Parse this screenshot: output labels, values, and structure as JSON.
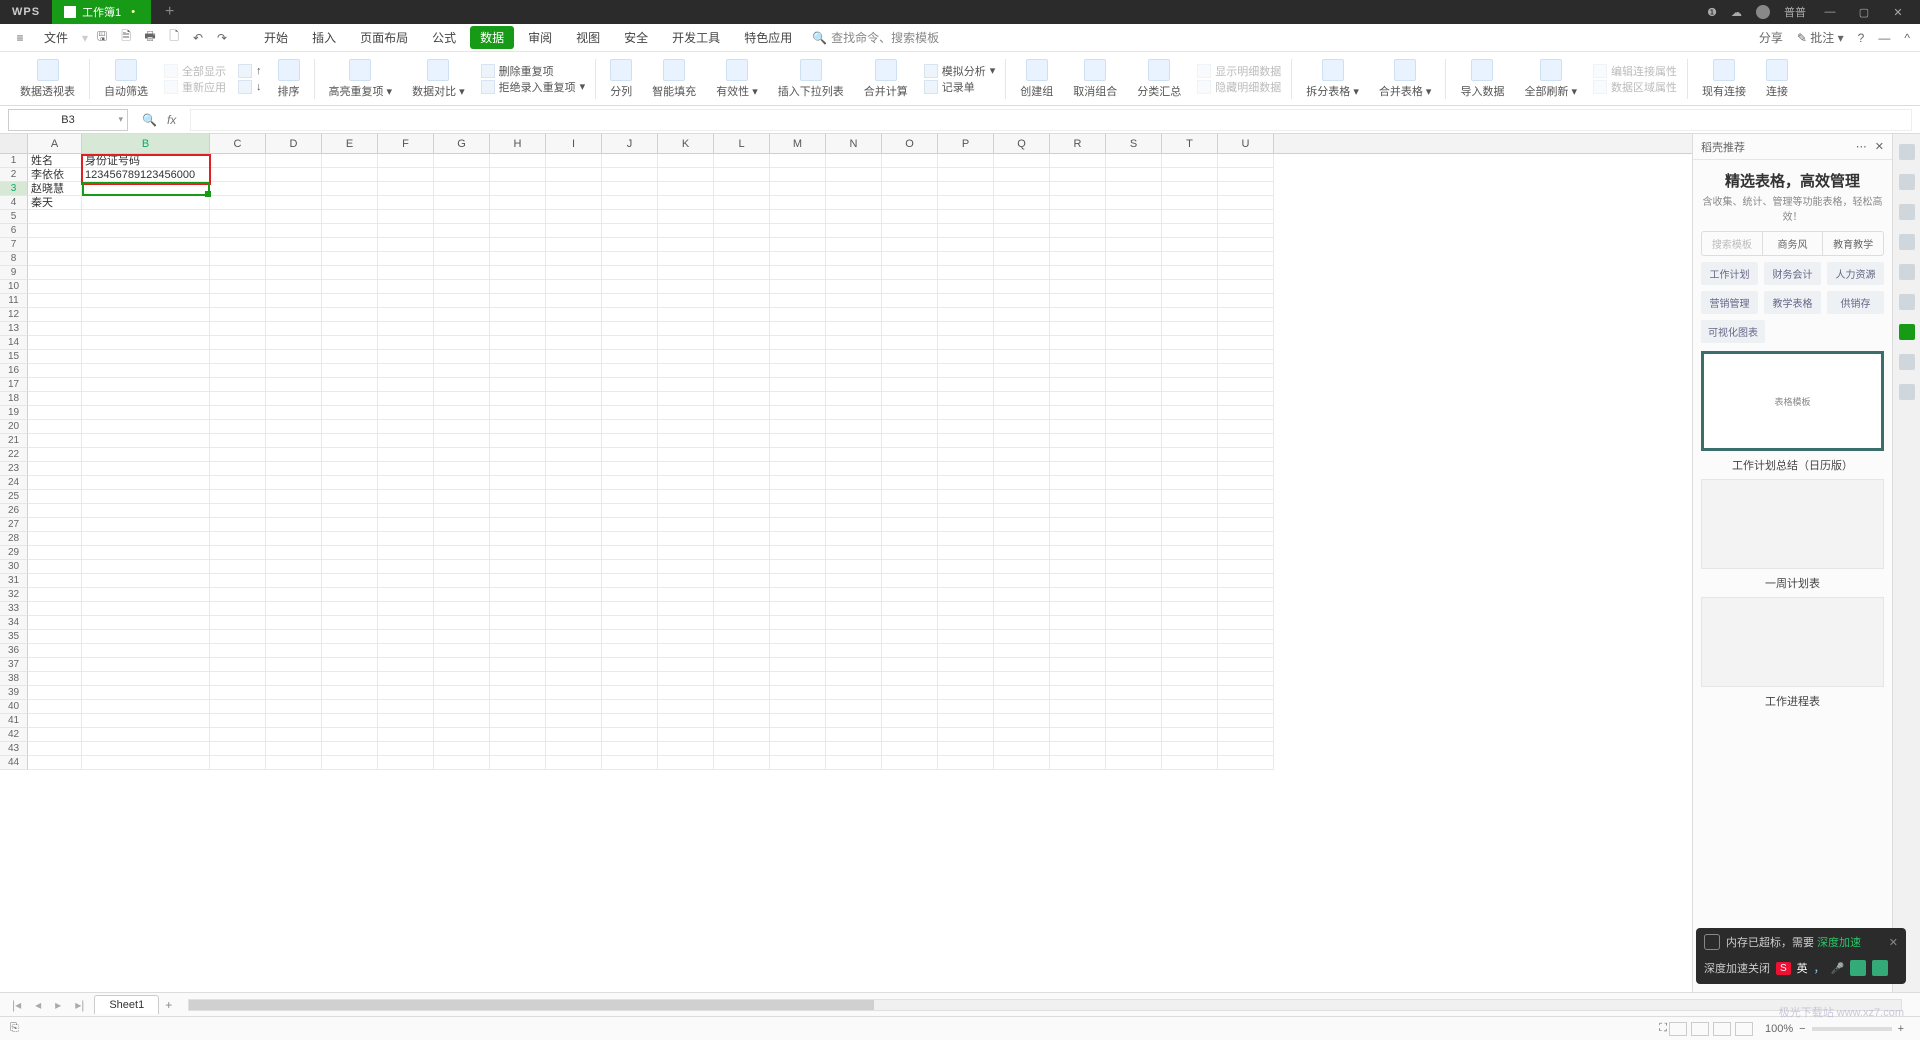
{
  "titlebar": {
    "logo": "WPS",
    "tab_name": "工作簿1",
    "user_name": "普普"
  },
  "menubar": {
    "file": "文件",
    "items": [
      "开始",
      "插入",
      "页面布局",
      "公式",
      "数据",
      "审阅",
      "视图",
      "安全",
      "开发工具",
      "特色应用"
    ],
    "active_index": 4,
    "search_placeholder": "查找命令、搜索模板",
    "share": "分享",
    "comment": "批注"
  },
  "ribbon": {
    "pivot": "数据透视表",
    "autofilter": "自动筛选",
    "showall": "全部显示",
    "reapply": "重新应用",
    "sort_asc": "↑",
    "sort_desc": "↓",
    "sort": "排序",
    "highlight": "高亮重复项",
    "compare": "数据对比",
    "remove_dup": "删除重复项",
    "reject_dup": "拒绝录入重复项",
    "split": "分列",
    "smartfill": "智能填充",
    "validity": "有效性",
    "dropdown": "插入下拉列表",
    "consolidate": "合并计算",
    "simulate": "模拟分析",
    "record": "记录单",
    "group": "创建组",
    "ungroup": "取消组合",
    "subtotal": "分类汇总",
    "show_detail": "显示明细数据",
    "hide_detail": "隐藏明细数据",
    "split_sheet": "拆分表格",
    "merge_sheet": "合并表格",
    "import": "导入数据",
    "refresh": "全部刷新",
    "edit_conn": "编辑连接属性",
    "data_region": "数据区域属性",
    "existing_conn": "现有连接",
    "connections": "连接"
  },
  "namebox": {
    "ref": "B3"
  },
  "columns": [
    "A",
    "B",
    "C",
    "D",
    "E",
    "F",
    "G",
    "H",
    "I",
    "J",
    "K",
    "L",
    "M",
    "N",
    "O",
    "P",
    "Q",
    "R",
    "S",
    "T",
    "U"
  ],
  "grid": {
    "A1": "姓名",
    "B1": "身份证号码",
    "A2": "李依依",
    "B2": "123456789123456000",
    "A3": "赵晓慧",
    "A4": "秦天"
  },
  "rpanel": {
    "header": "稻壳推荐",
    "title": "精选表格，高效管理",
    "sub": "含收集、统计、管理等功能表格，轻松高效！",
    "tabs": [
      "搜索模板",
      "商务风",
      "教育教学"
    ],
    "tags1": [
      "工作计划",
      "财务会计",
      "人力资源"
    ],
    "tags2": [
      "营销管理",
      "教学表格",
      "供销存"
    ],
    "tags3": [
      "可视化图表"
    ],
    "card1_cap": "工作计划总结（日历版）",
    "card2_cap": "一周计划表",
    "card3_cap": "工作进程表"
  },
  "sheet": {
    "name": "Sheet1"
  },
  "status": {
    "zoom": "100%"
  },
  "toast": {
    "line1a": "内存已超标，需要",
    "line1b": "深度加速",
    "line2": "深度加速关闭",
    "ime_s": "S",
    "ime_lang": "英"
  },
  "watermark": "极光下载站 www.xz7.com"
}
